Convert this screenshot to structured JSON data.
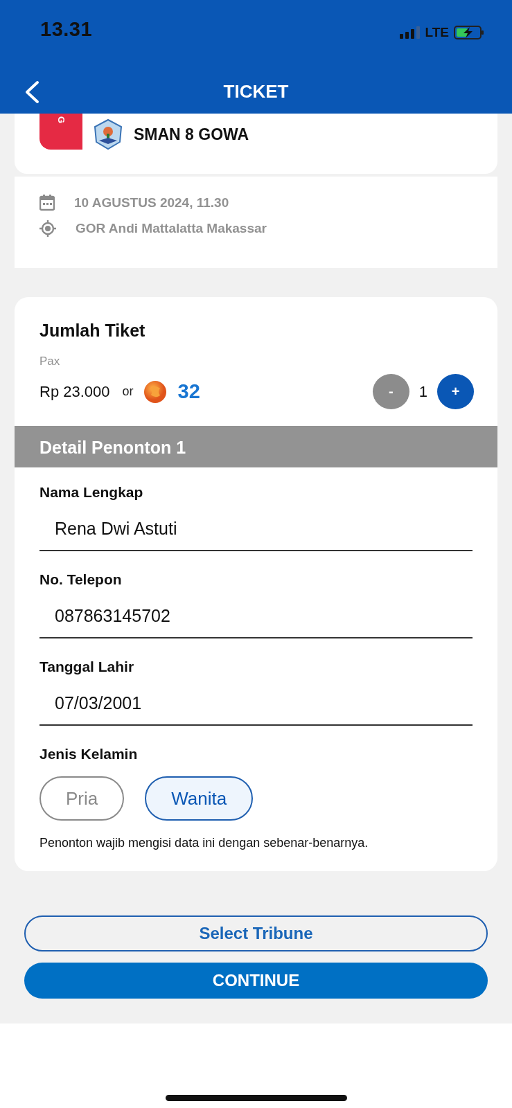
{
  "status_bar": {
    "time": "13.31",
    "network": "LTE"
  },
  "header": {
    "title": "TICKET"
  },
  "match_card": {
    "badge_letter": "G",
    "team_name": "SMAN 8 GOWA"
  },
  "event_info": {
    "date": "10 AGUSTUS 2024, 11.30",
    "venue": "GOR Andi Mattalatta Makassar"
  },
  "ticket": {
    "title": "Jumlah Tiket",
    "unit": "Pax",
    "price": "Rp 23.000",
    "separator": "or",
    "coin_price": "32",
    "decrement": "-",
    "quantity": "1",
    "increment": "+"
  },
  "viewer": {
    "title": "Detail Penonton 1",
    "fields": [
      {
        "label": "Nama Lengkap",
        "value": "Rena Dwi Astuti"
      },
      {
        "label": "No. Telepon",
        "value": "087863145702"
      },
      {
        "label": "Tanggal Lahir",
        "value": "07/03/2001"
      }
    ],
    "gender": {
      "label": "Jenis Kelamin",
      "options": [
        {
          "label": "Pria",
          "selected": false
        },
        {
          "label": "Wanita",
          "selected": true
        }
      ]
    },
    "note": "Penonton wajib mengisi data ini dengan sebenar-benarnya."
  },
  "buttons": [
    {
      "label": "Select Tribune",
      "kind": "outline"
    },
    {
      "label": "CONTINUE",
      "kind": "primary"
    }
  ]
}
